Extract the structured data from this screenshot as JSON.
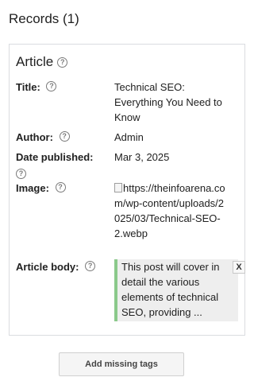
{
  "records": {
    "title": "Records (1)"
  },
  "article": {
    "heading": "Article",
    "help_icon": "question-circle",
    "fields": {
      "title": {
        "label": "Title:",
        "value": "Technical SEO: Everything You Need to Know"
      },
      "author": {
        "label": "Author:",
        "value": "Admin"
      },
      "date_published": {
        "label": "Date published:",
        "value": "Mar 3, 2025"
      },
      "image": {
        "label": "Image:",
        "value": "https://theinfoarena.com/wp-content/uploads/2025/03/Technical-SEO-2.webp",
        "icon": "broken-image"
      },
      "article_body": {
        "label": "Article body:",
        "value": "This post will cover in detail the various elements of technical SEO, providing ...",
        "accent_color": "#8bc98b",
        "remove_label": "X"
      }
    }
  },
  "actions": {
    "add_missing_tags": "Add missing tags"
  }
}
